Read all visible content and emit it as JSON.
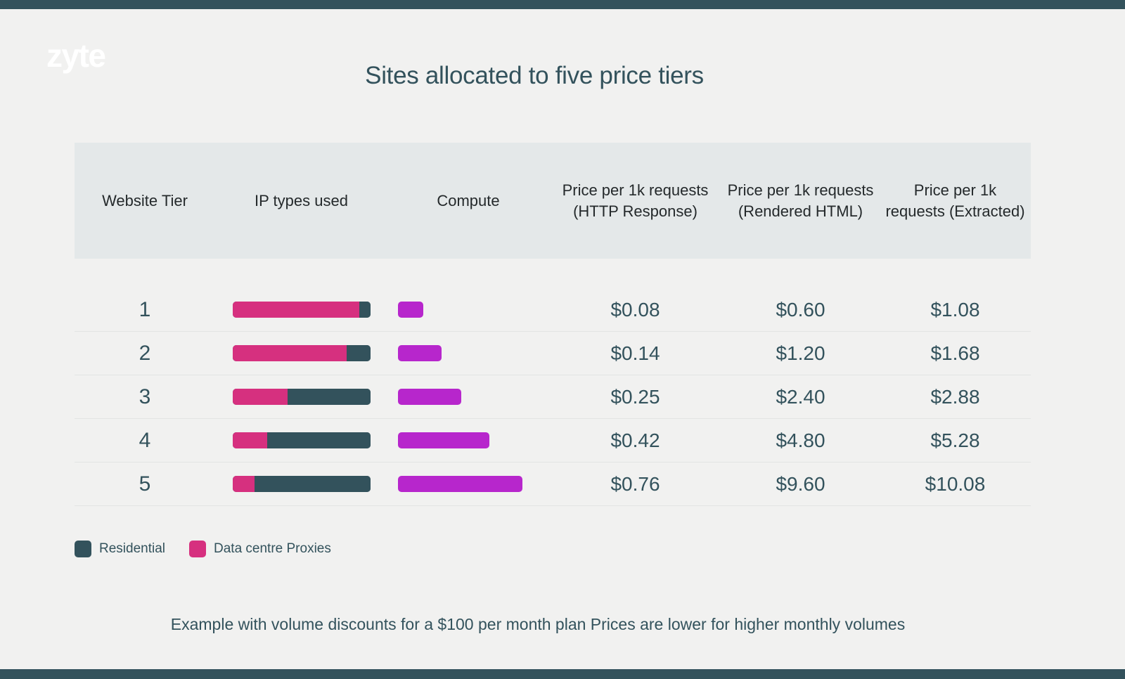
{
  "brand": {
    "logo_text": "zyte",
    "accent_dark": "#33525c",
    "pink": "#d6307f",
    "purple": "#b726cc",
    "header_bg": "#e4e8e9",
    "page_bg": "#f1f1f0"
  },
  "title": "Sites allocated to five price tiers",
  "note": "Example with volume discounts for a $100 per month plan Prices are lower for higher monthly volumes",
  "table": {
    "headers": {
      "tier": "Website Tier",
      "ip": "IP types used",
      "compute": "Compute",
      "price_http": "Price per 1k requests (HTTP Response)",
      "price_rendered": "Price per 1k requests (Rendered HTML)",
      "price_extracted": "Price per 1k requests (Extracted)"
    },
    "rows": [
      {
        "tier": "1",
        "datacentre_pct": 92,
        "residential_pct": 8,
        "compute_width": 36,
        "price_http": "$0.08",
        "price_rendered": "$0.60",
        "price_extracted": "$1.08"
      },
      {
        "tier": "2",
        "datacentre_pct": 83,
        "residential_pct": 17,
        "compute_width": 62,
        "price_http": "$0.14",
        "price_rendered": "$1.20",
        "price_extracted": "$1.68"
      },
      {
        "tier": "3",
        "datacentre_pct": 40,
        "residential_pct": 60,
        "compute_width": 90,
        "price_http": "$0.25",
        "price_rendered": "$2.40",
        "price_extracted": "$2.88"
      },
      {
        "tier": "4",
        "datacentre_pct": 25,
        "residential_pct": 75,
        "compute_width": 130,
        "price_http": "$0.42",
        "price_rendered": "$4.80",
        "price_extracted": "$5.28"
      },
      {
        "tier": "5",
        "datacentre_pct": 16,
        "residential_pct": 84,
        "compute_width": 177,
        "price_http": "$0.76",
        "price_rendered": "$9.60",
        "price_extracted": "$10.08"
      }
    ]
  },
  "legend": [
    {
      "label": "Residential",
      "color": "#33525c"
    },
    {
      "label": "Data centre Proxies",
      "color": "#d6307f"
    }
  ],
  "chart_data": {
    "type": "table",
    "title": "Sites allocated to five price tiers",
    "categories": [
      "1",
      "2",
      "3",
      "4",
      "5"
    ],
    "xlabel": "Website Tier",
    "ylabel": "",
    "legend": [
      "Residential",
      "Data centre Proxies"
    ],
    "annotations": [
      "Example with volume discounts for a $100 per month plan Prices are lower for higher monthly volumes"
    ],
    "series": [
      {
        "name": "Data centre Proxies (% of IP mix)",
        "values": [
          92,
          83,
          40,
          25,
          16
        ]
      },
      {
        "name": "Residential (% of IP mix)",
        "values": [
          8,
          17,
          60,
          75,
          84
        ]
      },
      {
        "name": "Compute (relative bar length px)",
        "values": [
          36,
          62,
          90,
          130,
          177
        ]
      },
      {
        "name": "Price per 1k requests (HTTP Response)",
        "values": [
          0.08,
          0.14,
          0.25,
          0.42,
          0.76
        ]
      },
      {
        "name": "Price per 1k requests (Rendered HTML)",
        "values": [
          0.6,
          1.2,
          2.4,
          4.8,
          9.6
        ]
      },
      {
        "name": "Price per 1k requests (Extracted)",
        "values": [
          1.08,
          1.68,
          2.88,
          5.28,
          10.08
        ]
      }
    ]
  }
}
